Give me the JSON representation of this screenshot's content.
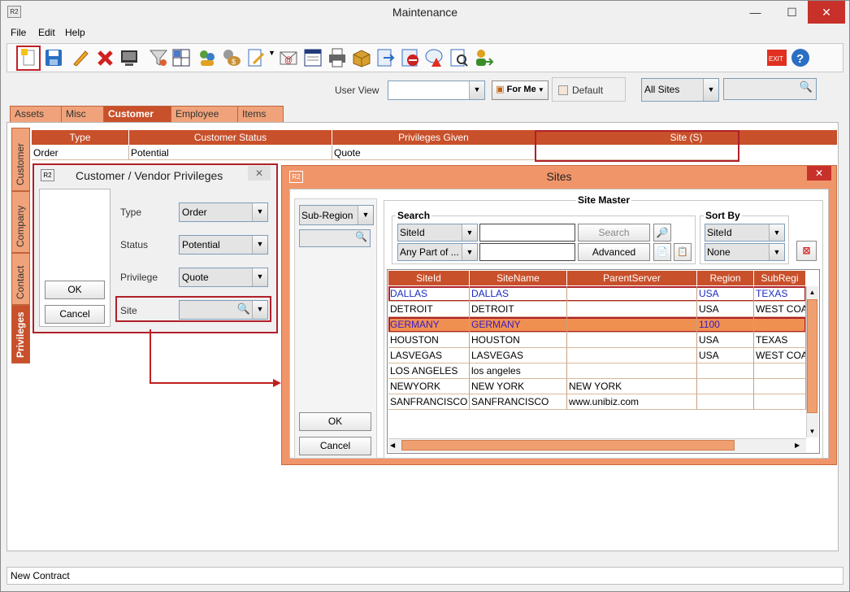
{
  "window": {
    "title": "Maintenance",
    "minimize": "—",
    "maximize": "☐",
    "close": "✕"
  },
  "menu": [
    "File",
    "Edit",
    "Help"
  ],
  "userview": {
    "label": "User View",
    "value": "",
    "for_me": "For Me",
    "default_label": "Default",
    "sites_value": "All Sites",
    "search_value": ""
  },
  "tabs": [
    "Assets",
    "Misc",
    "Customer",
    "Employee",
    "Items"
  ],
  "vtabs": [
    "Customer",
    "Company",
    "Contact",
    "Privileges"
  ],
  "grid": {
    "headers": [
      "Type",
      "Customer Status",
      "Privileges Given",
      "Site (S)"
    ],
    "row": [
      "Order",
      "Potential",
      "Quote",
      ""
    ]
  },
  "privileges_dialog": {
    "title": "Customer / Vendor Privileges",
    "ok": "OK",
    "cancel": "Cancel",
    "type_label": "Type",
    "type_value": "Order",
    "status_label": "Status",
    "status_value": "Potential",
    "privilege_label": "Privilege",
    "privilege_value": "Quote",
    "site_label": "Site",
    "site_value": ""
  },
  "sites_dialog": {
    "title": "Sites",
    "subregion": "Sub-Region",
    "ok": "OK",
    "cancel": "Cancel",
    "site_master": "Site Master",
    "search_legend": "Search",
    "search_field": "SiteId",
    "search_mode": "Any Part of ...",
    "search_btn": "Search",
    "advanced_btn": "Advanced",
    "sortby_legend": "Sort By",
    "sort_field": "SiteId",
    "sort_order": "None",
    "columns": [
      "SiteId",
      "SiteName",
      "ParentServer",
      "Region",
      "SubRegi"
    ],
    "rows": [
      {
        "cells": [
          "DALLAS",
          "DALLAS",
          "",
          "USA",
          "TEXAS"
        ],
        "style": "blue"
      },
      {
        "cells": [
          "DETROIT",
          "DETROIT",
          "",
          "USA",
          "WEST COA"
        ],
        "style": ""
      },
      {
        "cells": [
          "GERMANY",
          "GERMANY",
          "",
          "1100",
          ""
        ],
        "style": "selected"
      },
      {
        "cells": [
          "HOUSTON",
          "HOUSTON",
          "",
          "USA",
          "TEXAS"
        ],
        "style": ""
      },
      {
        "cells": [
          "LASVEGAS",
          "LASVEGAS",
          "",
          "USA",
          "WEST COA"
        ],
        "style": ""
      },
      {
        "cells": [
          "LOS ANGELES",
          "los angeles",
          "",
          "",
          ""
        ],
        "style": ""
      },
      {
        "cells": [
          "NEWYORK",
          "NEW YORK",
          "NEW YORK",
          "",
          ""
        ],
        "style": ""
      },
      {
        "cells": [
          "SANFRANCISCO",
          "SANFRANCISCO",
          "www.unibiz.com",
          "",
          ""
        ],
        "style": ""
      }
    ]
  },
  "statusbar": {
    "text": "New Contract"
  },
  "colors": {
    "accent": "#c8502a",
    "tab": "#f0a37a",
    "highlight_box": "#b0202a",
    "selected_row": "#f09050"
  }
}
